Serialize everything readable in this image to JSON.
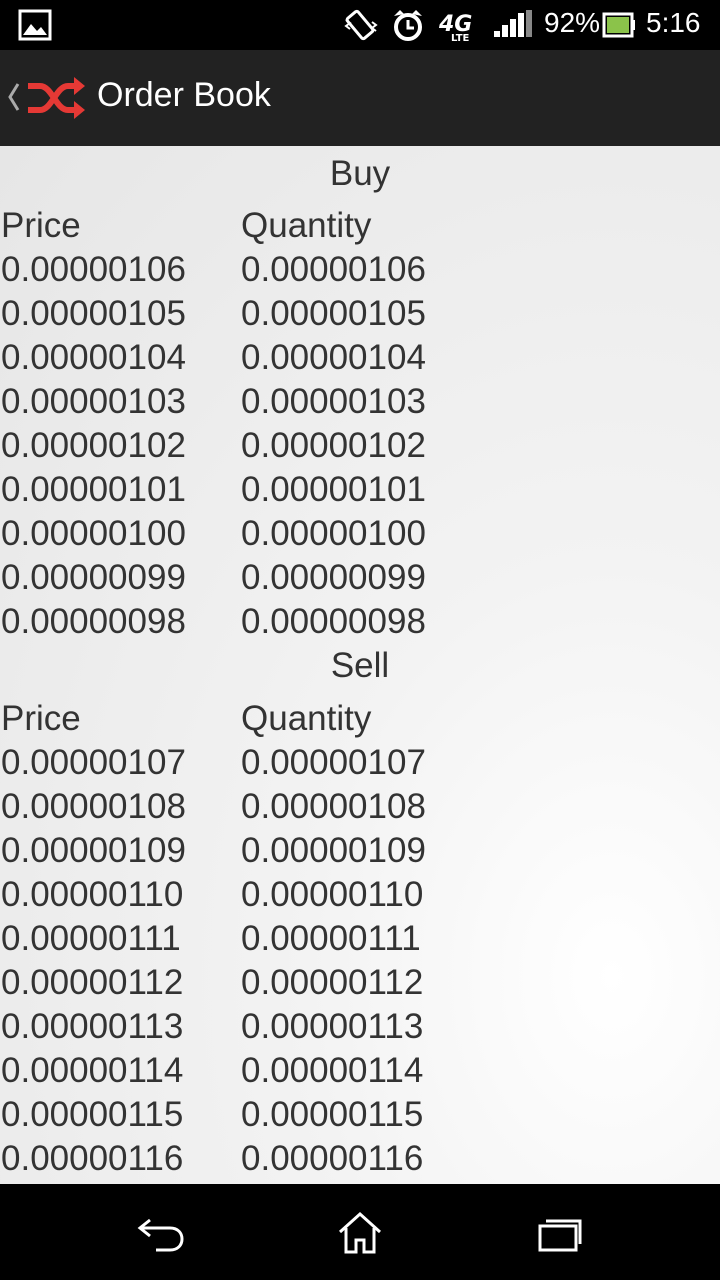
{
  "status_bar": {
    "battery_percent": "92%",
    "time": "5:16",
    "network_label": "4G",
    "network_sub": "LTE",
    "signal_bars": 4,
    "battery_level": 0.92,
    "icons": [
      "picture-icon",
      "vibrate-icon",
      "alarm-clock-icon",
      "network-4g-lte-icon",
      "signal-icon",
      "battery-icon"
    ]
  },
  "action_bar": {
    "title": "Order Book",
    "logo_color": "#e53935",
    "icons": [
      "back-chevron-icon",
      "shuffle-logo-icon"
    ]
  },
  "buy": {
    "heading": "Buy",
    "col_price": "Price",
    "col_quantity": "Quantity",
    "rows": [
      {
        "price": "0.00000106",
        "quantity": "0.00000106"
      },
      {
        "price": "0.00000105",
        "quantity": "0.00000105"
      },
      {
        "price": "0.00000104",
        "quantity": "0.00000104"
      },
      {
        "price": "0.00000103",
        "quantity": "0.00000103"
      },
      {
        "price": "0.00000102",
        "quantity": "0.00000102"
      },
      {
        "price": "0.00000101",
        "quantity": "0.00000101"
      },
      {
        "price": "0.00000100",
        "quantity": "0.00000100"
      },
      {
        "price": "0.00000099",
        "quantity": "0.00000099"
      },
      {
        "price": "0.00000098",
        "quantity": "0.00000098"
      }
    ]
  },
  "sell": {
    "heading": "Sell",
    "col_price": "Price",
    "col_quantity": "Quantity",
    "rows": [
      {
        "price": "0.00000107",
        "quantity": "0.00000107"
      },
      {
        "price": "0.00000108",
        "quantity": "0.00000108"
      },
      {
        "price": "0.00000109",
        "quantity": "0.00000109"
      },
      {
        "price": "0.00000110",
        "quantity": "0.00000110"
      },
      {
        "price": "0.00000111",
        "quantity": "0.00000111"
      },
      {
        "price": "0.00000112",
        "quantity": "0.00000112"
      },
      {
        "price": "0.00000113",
        "quantity": "0.00000113"
      },
      {
        "price": "0.00000114",
        "quantity": "0.00000114"
      },
      {
        "price": "0.00000115",
        "quantity": "0.00000115"
      },
      {
        "price": "0.00000116",
        "quantity": "0.00000116"
      }
    ]
  },
  "nav_bar": {
    "icons": [
      "back-icon",
      "home-icon",
      "recent-apps-icon"
    ]
  }
}
